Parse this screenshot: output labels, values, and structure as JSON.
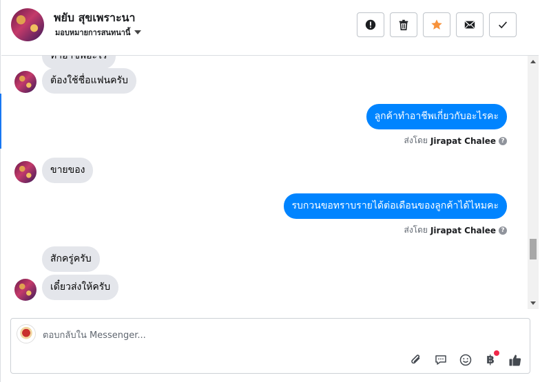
{
  "header": {
    "name": "พยับ สุขเพราะนา",
    "assign_label": "มอบหมายการสนทนานี้",
    "actions": [
      {
        "name": "report-button",
        "icon": "exclamation-icon"
      },
      {
        "name": "delete-button",
        "icon": "trash-icon"
      },
      {
        "name": "star-button",
        "icon": "star-icon"
      },
      {
        "name": "mark-unread-button",
        "icon": "envelope-icon"
      },
      {
        "name": "mark-done-button",
        "icon": "check-icon"
      }
    ]
  },
  "messages": {
    "m0": "ทำอาชีพอะไร",
    "m1": "ต้องใช้ชื่อแฟนครับ",
    "m2": "ลูกค้าทำอาชีพเกี่ยวกับอะไรคะ",
    "m2_sent_by_prefix": "ส่งโดย",
    "m2_sender": "Jirapat Chalee",
    "m3": "ขายของ",
    "m4": "รบกวนขอทราบรายได้ต่อเดือนของลูกค้าได้ไหมคะ",
    "m4_sent_by_prefix": "ส่งโดย",
    "m4_sender": "Jirapat Chalee",
    "m5": "สักครู่ครับ",
    "m6": "เดี๋ยวส่งให้ครับ"
  },
  "composer": {
    "placeholder": "ตอบกลับใน Messenger...",
    "value": "",
    "tools": [
      "paperclip-icon",
      "saved-reply-icon",
      "emoji-icon",
      "baht-payment-icon",
      "thumbs-up-icon"
    ],
    "baht_symbol": "฿"
  },
  "colors": {
    "outgoing_bubble": "#0084ff",
    "incoming_bubble": "#e4e6eb",
    "star": "#f7923b",
    "accent": "#1877f2"
  }
}
